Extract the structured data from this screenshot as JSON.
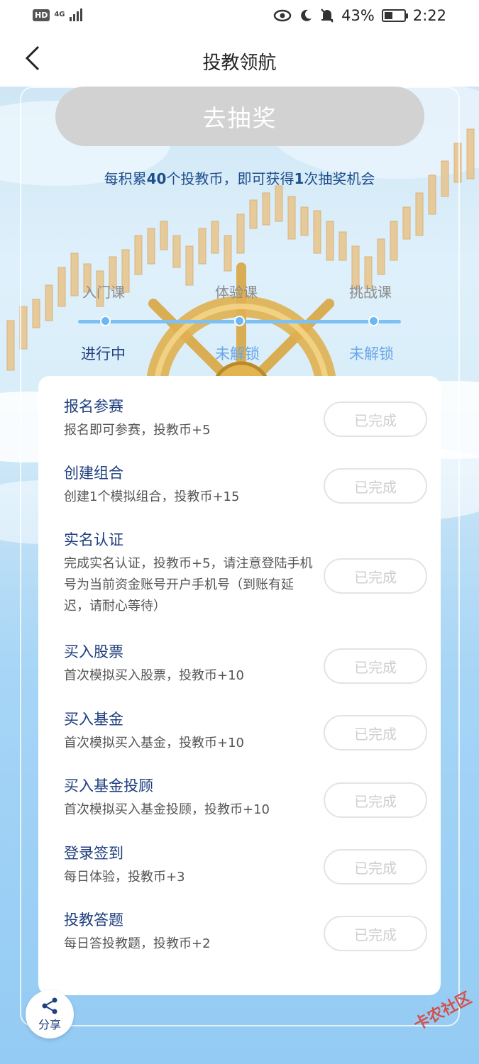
{
  "status_bar": {
    "hd": "HD",
    "network": "4G",
    "battery": "43%",
    "battery_level": 0.43,
    "time": "2:22"
  },
  "header": {
    "title": "投教领航"
  },
  "lottery": {
    "button_label": "去抽奖",
    "tip_prefix": "每积累",
    "tip_number": "40",
    "tip_middle": "个投教币，即可获得",
    "tip_number2": "1",
    "tip_suffix": "次抽奖机会"
  },
  "progress": {
    "courses": [
      {
        "label": "入门课",
        "status": "进行中",
        "status_color": "#1f3f7d"
      },
      {
        "label": "体验课",
        "status": "未解锁",
        "status_color": "#6aa6e8"
      },
      {
        "label": "挑战课",
        "status": "未解锁",
        "status_color": "#6aa6e8"
      }
    ]
  },
  "tasks": [
    {
      "title": "报名参赛",
      "desc": "报名即可参赛，投教币+5",
      "button": "已完成"
    },
    {
      "title": "创建组合",
      "desc": "创建1个模拟组合，投教币+15",
      "button": "已完成"
    },
    {
      "title": "实名认证",
      "desc": "完成实名认证，投教币+5，请注意登陆手机号为当前资金账号开户手机号（到账有延迟，请耐心等待）",
      "button": "已完成"
    },
    {
      "title": "买入股票",
      "desc": "首次模拟买入股票，投教币+10",
      "button": "已完成"
    },
    {
      "title": "买入基金",
      "desc": "首次模拟买入基金，投教币+10",
      "button": "已完成"
    },
    {
      "title": "买入基金投顾",
      "desc": "首次模拟买入基金投顾，投教币+10",
      "button": "已完成"
    },
    {
      "title": "登录签到",
      "desc": "每日体验，投教币+3",
      "button": "已完成"
    },
    {
      "title": "投教答题",
      "desc": "每日答投教题，投教币+2",
      "button": "已完成"
    }
  ],
  "share": {
    "label": "分享",
    "icon": "share-icon"
  },
  "watermark": "卡农社区"
}
